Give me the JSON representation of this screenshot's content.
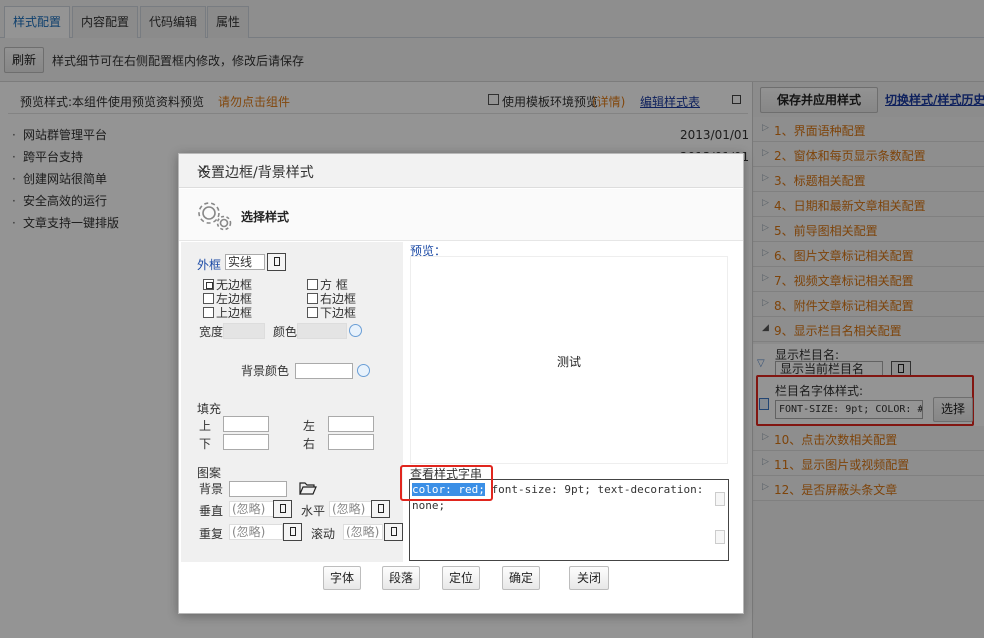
{
  "tabs": [
    "样式配置",
    "内容配置",
    "代码编辑",
    "属性"
  ],
  "toolbar": {
    "refresh_label": "刷新",
    "tip": "样式细节可在右侧配置框内修改，修改后请保存"
  },
  "preview_header": {
    "text": "预览样式:本组件使用预览资料预览",
    "warning": "请勿点击组件",
    "template_label": "使用模板环境预览",
    "details": "(详情)",
    "edit_link": "编辑样式表"
  },
  "news": [
    {
      "title": "网站群管理平台",
      "date": "2013/01/01"
    },
    {
      "title": "跨平台支持",
      "date": "2013/01/01"
    },
    {
      "title": "创建网站很简单",
      "date": ""
    },
    {
      "title": "安全高效的运行",
      "date": ""
    },
    {
      "title": "文章支持一键排版",
      "date": ""
    }
  ],
  "right_panel": {
    "save_label": "保存并应用样式",
    "switch_link": "切换样式/样式历史",
    "sections": [
      "1、界面语种配置",
      "2、窗体和每页显示条数配置",
      "3、标题相关配置",
      "4、日期和最新文章相关配置",
      "5、前导图相关配置",
      "6、图片文章标记相关配置",
      "7、视频文章标记相关配置",
      "8、附件文章标记相关配置",
      "9、显示栏目名相关配置",
      "10、点击次数相关配置",
      "11、显示图片或视频配置",
      "12、是否屏蔽头条文章"
    ],
    "show_column_label": "显示栏目名:",
    "show_column_value": "显示当前栏目名",
    "font_style_label": "栏目名字体样式:",
    "font_style_value": "FONT-SIZE: 9pt; COLOR: #",
    "choose_label": "选择"
  },
  "modal": {
    "title": "设置边框/背景样式",
    "close": "×",
    "header": "选择样式",
    "outer_frame_label": "外框",
    "outer_frame_value": "实线",
    "checkboxes": {
      "no_border": "无边框",
      "square": "方  框",
      "left": "左边框",
      "right": "右边框",
      "top": "上边框",
      "bottom": "下边框"
    },
    "width_label": "宽度",
    "color_label": "颜色",
    "bg_color_label": "背景颜色",
    "padding_label": "填充",
    "pad_top": "上",
    "pad_left": "左",
    "pad_bottom": "下",
    "pad_right": "右",
    "pattern_label": "图案",
    "bg_label": "背景",
    "vertical_label": "垂直",
    "horizontal_label": "水平",
    "repeat_label": "重复",
    "scroll_label": "滚动",
    "ignore": "(忽略)",
    "preview_label": "预览：",
    "preview_text": "测试",
    "css_label": "查看样式字串",
    "css_highlight": "color: red;",
    "css_rest": " font-size: 9pt; text-decoration: none;",
    "buttons": [
      "字体",
      "段落",
      "定位",
      "确定",
      "关闭"
    ]
  }
}
